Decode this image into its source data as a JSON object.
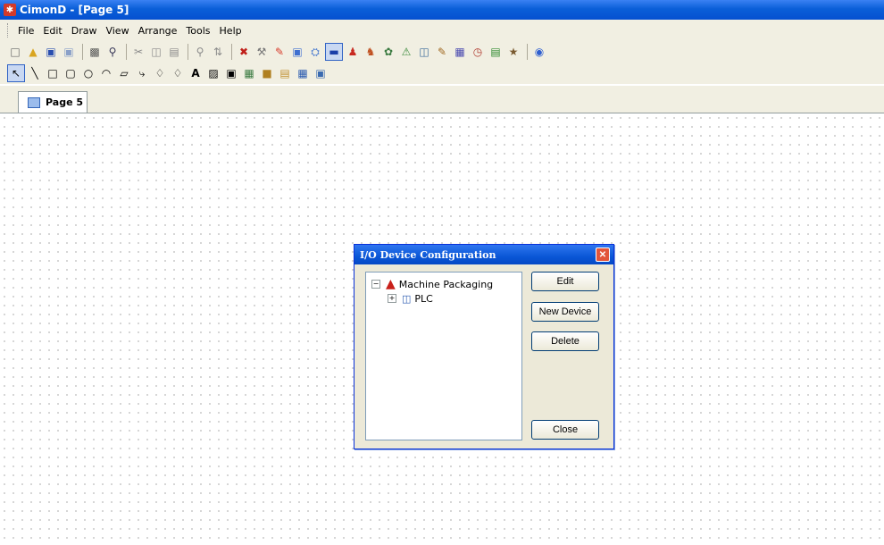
{
  "window": {
    "title": "CimonD - [Page 5]",
    "icon": "app-icon"
  },
  "menu": [
    "File",
    "Edit",
    "Draw",
    "View",
    "Arrange",
    "Tools",
    "Help"
  ],
  "tab": {
    "label": "Page 5"
  },
  "dialog": {
    "title": "I/O Device Configuration",
    "tree": {
      "root": {
        "label": "Machine Packaging",
        "expander": "−"
      },
      "child": {
        "label": "PLC",
        "expander": "+"
      }
    },
    "buttons": {
      "edit": "Edit",
      "new_device": "New Device",
      "delete": "Delete",
      "close": "Close"
    }
  }
}
